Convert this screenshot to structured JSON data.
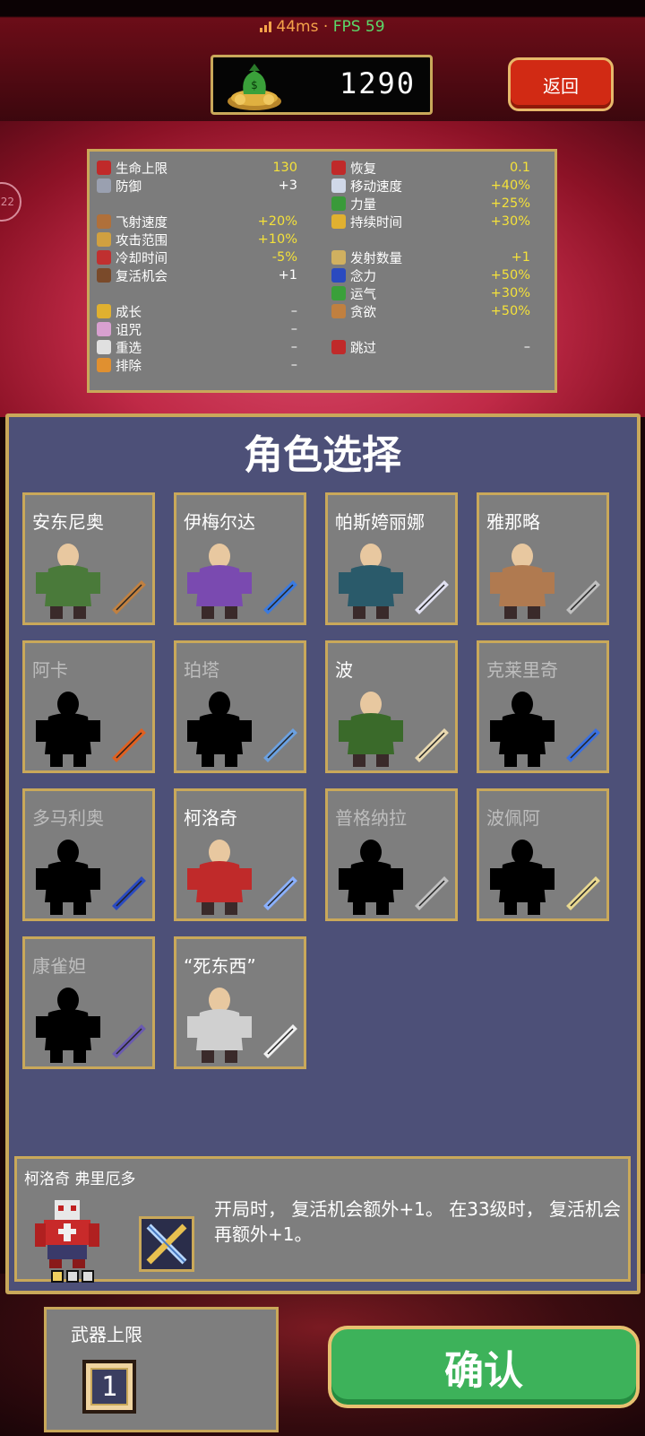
{
  "status": {
    "ping": "44ms",
    "separator": "·",
    "fps": "FPS 59"
  },
  "header": {
    "gold": "1290",
    "back_label": "返回"
  },
  "side_bubble": "22",
  "stats": {
    "left": [
      {
        "label": "生命上限",
        "value": "130",
        "color": "#f4e13a",
        "icon": "heart-icon"
      },
      {
        "label": "防御",
        "value": "+3",
        "color": "#ffffff",
        "icon": "armor-icon"
      },
      {
        "label": "飞射速度",
        "value": "+20%",
        "color": "#f4e13a",
        "icon": "arm-icon"
      },
      {
        "label": "攻击范围",
        "value": "+10%",
        "color": "#f4e13a",
        "icon": "candelabra-icon"
      },
      {
        "label": "冷却时间",
        "value": "-5%",
        "color": "#f4e13a",
        "icon": "tome-icon"
      },
      {
        "label": "复活机会",
        "value": "+1",
        "color": "#ffffff",
        "icon": "box-icon"
      },
      {
        "label": "成长",
        "value": "–",
        "color": "#ffffff",
        "icon": "crown-icon"
      },
      {
        "label": "诅咒",
        "value": "–",
        "color": "#ffffff",
        "icon": "skull-icon"
      },
      {
        "label": "重选",
        "value": "–",
        "color": "#ffffff",
        "icon": "dice-icon"
      },
      {
        "label": "排除",
        "value": "–",
        "color": "#ffffff",
        "icon": "banish-icon"
      }
    ],
    "right": [
      {
        "label": "恢复",
        "value": "0.1",
        "color": "#f4e13a",
        "icon": "heart-plus-icon"
      },
      {
        "label": "移动速度",
        "value": "+40%",
        "color": "#f4e13a",
        "icon": "wing-icon"
      },
      {
        "label": "力量",
        "value": "+25%",
        "color": "#f4e13a",
        "icon": "spinach-icon"
      },
      {
        "label": "持续时间",
        "value": "+30%",
        "color": "#f4e13a",
        "icon": "spellbinder-icon"
      },
      {
        "label": "发射数量",
        "value": "+1",
        "color": "#f4e13a",
        "icon": "duplicator-icon"
      },
      {
        "label": "念力",
        "value": "+50%",
        "color": "#f4e13a",
        "icon": "attractorb-icon"
      },
      {
        "label": "运气",
        "value": "+30%",
        "color": "#f4e13a",
        "icon": "clover-icon"
      },
      {
        "label": "贪欲",
        "value": "+50%",
        "color": "#f4e13a",
        "icon": "stone-mask-icon"
      },
      {
        "label": "跳过",
        "value": "–",
        "color": "#ffffff",
        "icon": "skip-icon"
      }
    ]
  },
  "panel": {
    "title": "角色选择"
  },
  "characters": [
    {
      "name": "安东尼奥",
      "locked": false,
      "color": "#4a7a3a",
      "weapon": "whip"
    },
    {
      "name": "伊梅尔达",
      "locked": false,
      "color": "#7a4ab0",
      "weapon": "wand"
    },
    {
      "name": "帕斯姱丽娜",
      "locked": false,
      "color": "#2a5a6a",
      "weapon": "runetracer"
    },
    {
      "name": "雅那略",
      "locked": false,
      "color": "#b07a50",
      "weapon": "knife"
    },
    {
      "name": "阿卡",
      "locked": true,
      "color": "#000000",
      "weapon": "axe"
    },
    {
      "name": "珀塔",
      "locked": true,
      "color": "#000000",
      "weapon": "lightning"
    },
    {
      "name": "波",
      "locked": false,
      "color": "#3a6a2a",
      "weapon": "garlic"
    },
    {
      "name": "克莱里奇",
      "locked": true,
      "color": "#000000",
      "weapon": "potion"
    },
    {
      "name": "多马利奥",
      "locked": true,
      "color": "#000000",
      "weapon": "bible"
    },
    {
      "name": "柯洛奇",
      "locked": false,
      "color": "#c02a2a",
      "weapon": "cross"
    },
    {
      "name": "普格纳拉",
      "locked": true,
      "color": "#000000",
      "weapon": "pistol"
    },
    {
      "name": "波佩阿",
      "locked": true,
      "color": "#000000",
      "weapon": "scroll"
    },
    {
      "name": "康雀妲",
      "locked": true,
      "color": "#000000",
      "weapon": "hat"
    },
    {
      "name": "“死东西”",
      "locked": false,
      "color": "#d0d0d0",
      "weapon": "bone"
    }
  ],
  "detail": {
    "name": "柯洛奇  弗里厄多",
    "description": "开局时， 复活机会额外+1。  在33级时， 复活机会再额外+1。"
  },
  "weapon_slots": {
    "label": "武器上限",
    "value": "1"
  },
  "confirm_label": "确认"
}
